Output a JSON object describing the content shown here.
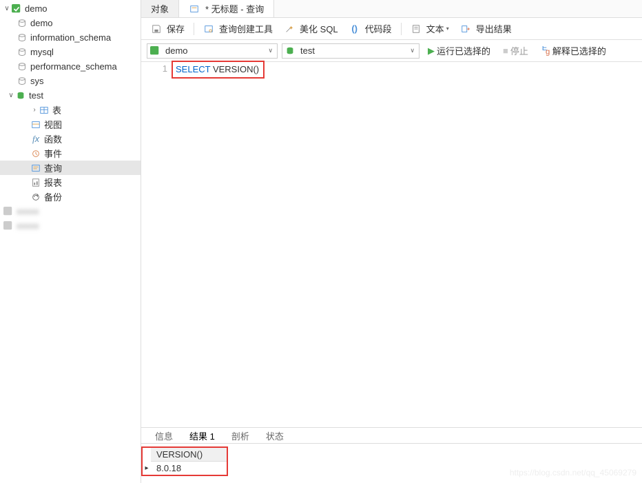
{
  "sidebar": {
    "root": "demo",
    "items": [
      {
        "icon": "db-gray",
        "label": "demo"
      },
      {
        "icon": "db-gray",
        "label": "information_schema"
      },
      {
        "icon": "db-gray",
        "label": "mysql"
      },
      {
        "icon": "db-gray",
        "label": "performance_schema"
      },
      {
        "icon": "db-gray",
        "label": "sys"
      }
    ],
    "test_db": "test",
    "children": [
      {
        "icon": "tbl",
        "label": "表"
      },
      {
        "icon": "view",
        "label": "视图"
      },
      {
        "icon": "fx",
        "label": "函数"
      },
      {
        "icon": "clock",
        "label": "事件"
      },
      {
        "icon": "query",
        "label": "查询",
        "selected": true
      },
      {
        "icon": "report",
        "label": "报表"
      },
      {
        "icon": "backup",
        "label": "备份"
      }
    ],
    "blurred": [
      "xxxxx",
      "xxxxx"
    ]
  },
  "tabs": {
    "object": "对象",
    "query": "* 无标题 - 查询"
  },
  "toolbar": {
    "save": "保存",
    "query_builder": "查询创建工具",
    "beautify": "美化 SQL",
    "snippet": "代码段",
    "text": "文本",
    "export": "导出结果"
  },
  "dropdowns": {
    "connection": "demo",
    "database": "test",
    "run": "运行已选择的",
    "stop": "停止",
    "explain": "解释已选择的"
  },
  "editor": {
    "line_no": "1",
    "sql_kw": "SELECT",
    "sql_rest": " VERSION()"
  },
  "result_tabs": {
    "info": "信息",
    "result": "结果 1",
    "profile": "剖析",
    "status": "状态"
  },
  "result": {
    "column": "VERSION()",
    "value": "8.0.18"
  },
  "watermark": "https://blog.csdn.net/qq_45069279"
}
